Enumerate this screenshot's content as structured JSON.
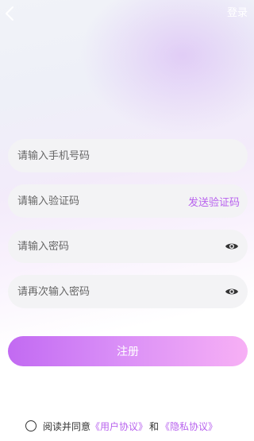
{
  "header": {
    "back_icon": "chevron-left-icon",
    "login_label": "登录"
  },
  "form": {
    "phone_placeholder": "请输入手机号码",
    "code_placeholder": "请输入验证码",
    "send_code_label": "发送验证码",
    "password_placeholder": "请输入密码",
    "confirm_password_placeholder": "请再次输入密码",
    "eye_icon": "eye-icon"
  },
  "register_label": "注册",
  "agreement": {
    "prefix": "阅读并同意",
    "user_agreement": "《用户协议》",
    "and": "和",
    "privacy_policy": "《隐私协议》"
  },
  "colors": {
    "accent": "#b862ee",
    "button_start": "#c26af2",
    "button_end": "#f7b0f5",
    "field_bg": "#f3f3f5"
  }
}
